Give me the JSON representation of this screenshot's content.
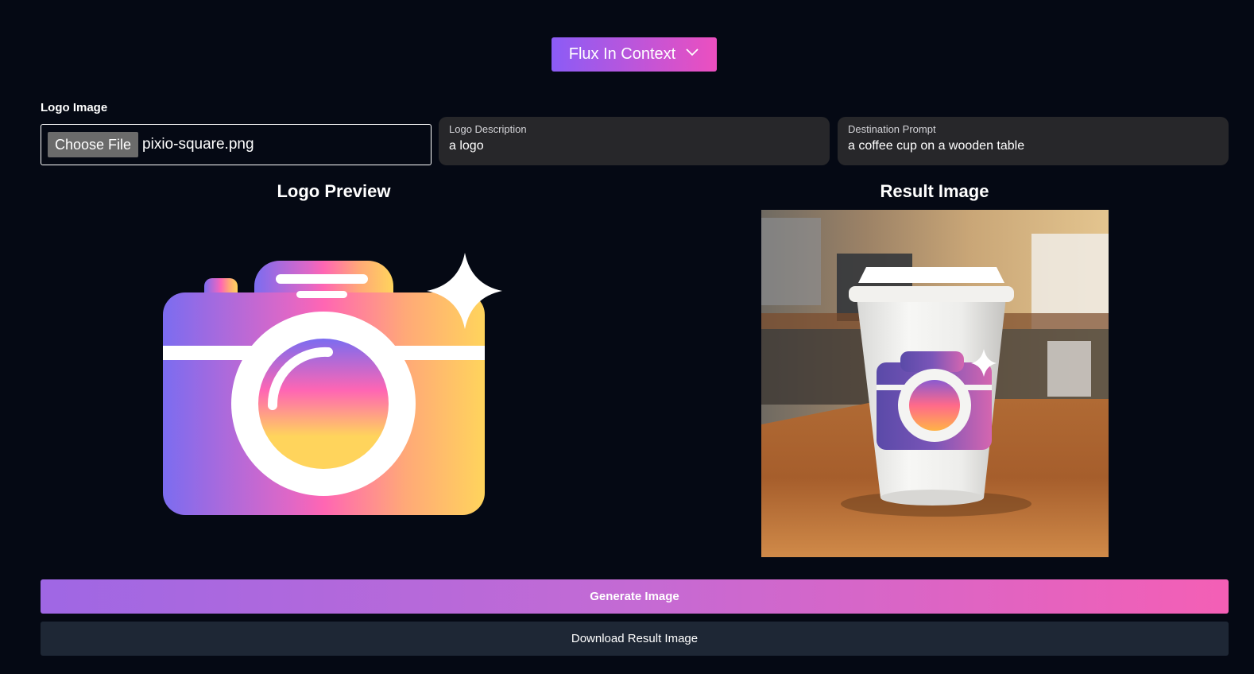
{
  "header": {
    "model_select": {
      "label": "Flux In Context"
    }
  },
  "form": {
    "logo_image": {
      "label": "Logo Image",
      "button_label": "Choose File",
      "file_name": "pixio-square.png"
    },
    "logo_description": {
      "label": "Logo Description",
      "value": "a logo"
    },
    "destination_prompt": {
      "label": "Destination Prompt",
      "value": "a coffee cup on a wooden table"
    }
  },
  "preview": {
    "logo_title": "Logo Preview",
    "result_title": "Result Image"
  },
  "actions": {
    "generate_label": "Generate Image",
    "download_label": "Download Result Image"
  },
  "colors": {
    "background": "#050914",
    "accent_start": "#8b5cf6",
    "accent_end": "#ec4fbf",
    "field_bg": "#27272a",
    "secondary_button_bg": "#1e2735"
  },
  "icons": {
    "model_select": "chevron-down-icon",
    "logo": "camera-sparkle-icon"
  }
}
